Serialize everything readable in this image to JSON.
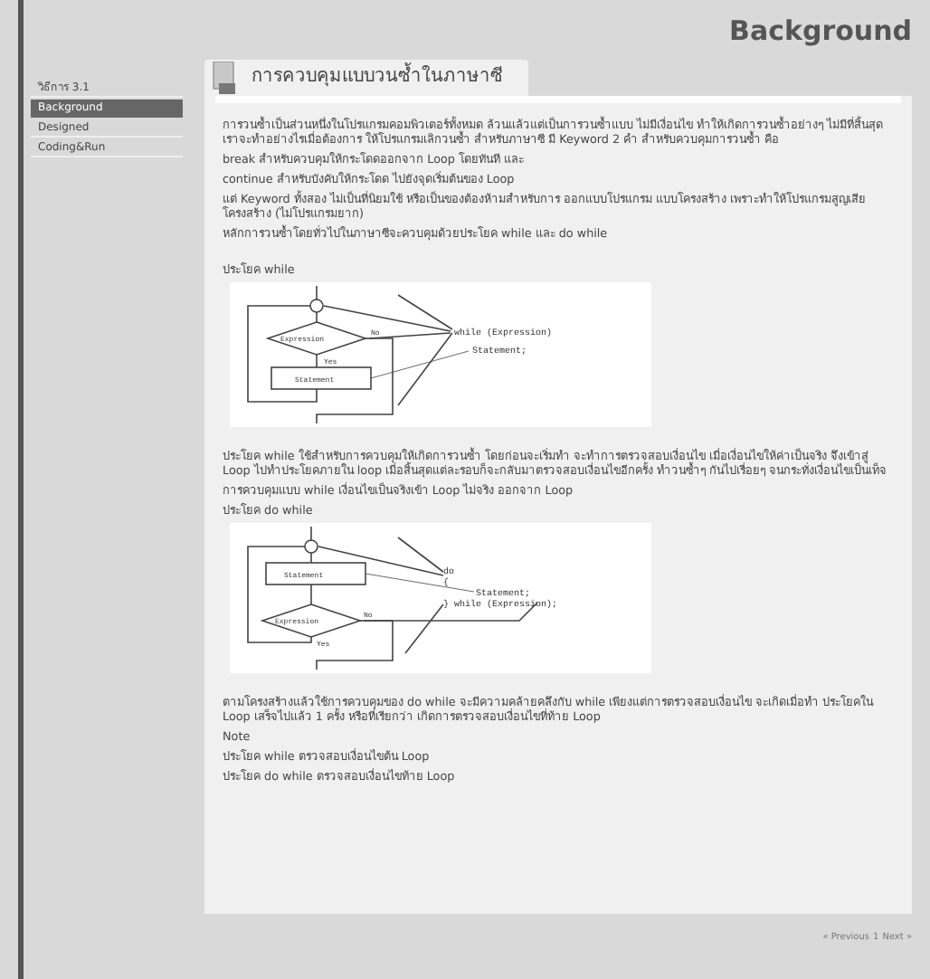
{
  "page_title": "Background",
  "sidebar": {
    "items": [
      {
        "label": "วิธีการ 3.1",
        "selected": false
      },
      {
        "label": "Background",
        "selected": true
      },
      {
        "label": "Designed",
        "selected": false
      },
      {
        "label": "Coding&Run",
        "selected": false
      }
    ]
  },
  "content": {
    "heading": "การควบคุมแบบวนซ้ำในภาษาซี",
    "blocks": [
      {
        "kind": "text",
        "text": "การวนซ้ำเป็นส่วนหนึ่งในโปรแกรมคอมพิวเตอร์ทั้งหมด ล้วนแล้วแต่เป็นการวนซ้ำแบบ ไม่มีเงื่อนไข ทำให้เกิดการวนซ้ำอย่างๆ ไม่มีที่สิ้นสุด เราจะทำอย่างไรเมื่อต้องการ ให้โปรแกรมเลิกวนซ้ำ สำหรับภาษาซี มี Keyword 2 คำ สำหรับควบคุมการวนซ้ำ คือ"
      },
      {
        "kind": "text",
        "text": "break สำหรับควบคุมให้กระโดดออกจาก Loop โดยทันที และ"
      },
      {
        "kind": "text",
        "text": "continue สำหรับบังคับให้กระโดด ไปยังจุดเริ่มต้นของ Loop"
      },
      {
        "kind": "text",
        "text": "แต่ Keyword ทั้งสอง ไม่เป็นที่นิยมใช้ หรือเป็นของต้องห้ามสำหรับการ ออกแบบโปรแกรม แบบโครงสร้าง เพราะทำให้โปรแกรมสูญเสียโครงสร้าง (ไม่โปรแกรมยาก)"
      },
      {
        "kind": "text",
        "text": "หลักการวนซ้ำโดยทั่วไปในภาษาซีจะควบคุมด้วยประโยค while และ do while"
      },
      {
        "kind": "gap"
      },
      {
        "kind": "text",
        "text": "ประโยค while"
      },
      {
        "kind": "while_diagram",
        "labels": {
          "expression": "Expression",
          "no": "No",
          "yes": "Yes",
          "statement": "Statement",
          "code_1": "while (Expression)",
          "code_2": "Statement;"
        }
      },
      {
        "kind": "gap"
      },
      {
        "kind": "text",
        "text": "ประโยค while ใช้สำหรับการควบคุมให้เกิดการวนซ้ำ โดยก่อนจะเริ่มทำ จะทำการตรวจสอบเงื่อนไข เมื่อเงื่อนไขให้ค่าเป็นจริง จึงเข้าสู่ Loop ไปทำประโยคภายใน loop เมื่อสิ้นสุดแต่ละรอบก็จะกลับมาตรวจสอบเงื่อนไขอีกครั้ง ทำวนซ้ำๆ กันไปเรื่อยๆ จนกระทั่งเงื่อนไขเป็นเท็จ"
      },
      {
        "kind": "text",
        "text": "การควบคุมแบบ while เงื่อนไขเป็นจริงเข้า Loop ไม่จริง ออกจาก Loop"
      },
      {
        "kind": "text",
        "text": "ประโยค do while"
      },
      {
        "kind": "do_while_diagram",
        "labels": {
          "expression": "Expression",
          "no": "No",
          "yes": "Yes",
          "statement": "Statement",
          "code_0": "do",
          "code_1": "{",
          "code_2": "Statement;",
          "code_3": "} while (Expression);"
        }
      },
      {
        "kind": "gap"
      },
      {
        "kind": "text",
        "text": "ตามโครงสร้างแล้วใช้การควบคุมของ do while จะมีความคล้ายคลึงกับ while เพียงแต่การตรวจสอบเงื่อนไข จะเกิดเมื่อทำ ประโยคใน Loop เสร็จไปแล้ว 1 ครั้ง หรือที่เรียกว่า เกิดการตรวจสอบเงื่อนไขที่ท้าย Loop"
      },
      {
        "kind": "text",
        "text": "Note"
      },
      {
        "kind": "text",
        "text": "ประโยค while ตรวจสอบเงื่อนไขต้น Loop"
      },
      {
        "kind": "text",
        "text": "ประโยค do while ตรวจสอบเงื่อนไขท้าย Loop"
      }
    ]
  },
  "pager": {
    "previous": "« Previous",
    "page": "1",
    "next": "Next »"
  }
}
